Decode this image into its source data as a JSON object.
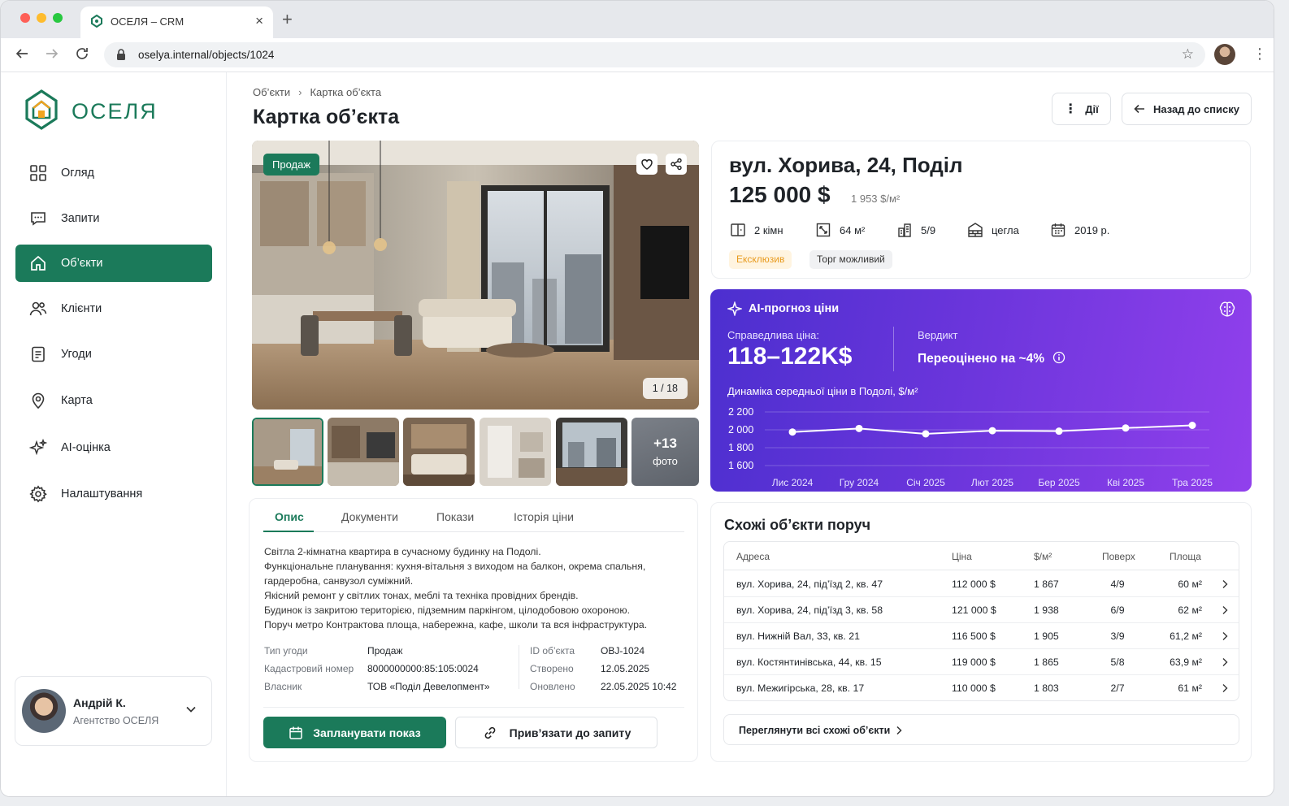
{
  "browser": {
    "tab_title": "ОСЕЛЯ – CRM",
    "url": "oselya.internal/objects/1024"
  },
  "sidebar": {
    "logo_text": "ОСЕЛЯ",
    "items": [
      {
        "label": "Огляд",
        "icon": "grid-icon",
        "active": false
      },
      {
        "label": "Запити",
        "icon": "chat-icon",
        "active": false
      },
      {
        "label": "Об’єкти",
        "icon": "home-icon",
        "active": true
      },
      {
        "label": "Клієнти",
        "icon": "users-icon",
        "active": false
      },
      {
        "label": "Угоди",
        "icon": "document-icon",
        "active": false
      },
      {
        "label": "Карта",
        "icon": "map-pin-icon",
        "active": false
      },
      {
        "label": "AI-оцінка",
        "icon": "sparkles-icon",
        "active": false
      },
      {
        "label": "Налаштування",
        "icon": "gear-icon",
        "active": false
      }
    ],
    "user": {
      "name": "Андрій К.",
      "org": "Агентство ОСЕЛЯ"
    }
  },
  "header": {
    "breadcrumb": [
      "Об’єкти",
      "Картка об’єкта"
    ],
    "title": "Картка об’єкта",
    "actions_label": "Дії",
    "back_label": "Назад до списку"
  },
  "gallery": {
    "badge": "Продаж",
    "counter": "1 / 18",
    "more_count": "+13",
    "more_label": "фото"
  },
  "tabs": [
    "Опис",
    "Документи",
    "Покази",
    "Історія ціни"
  ],
  "description": [
    "Світла 2-кімнатна квартира в сучасному будинку на Подолі.",
    "Функціональне планування: кухня-вітальня з виходом на балкон, окрема спальня,",
    "гардеробна, санвузол суміжний.",
    "Якісний ремонт у світлих тонах, меблі та техніка провідних брендів.",
    "Будинок із закритою територією, підземним паркінгом, цілодобовою охороною.",
    "Поруч метро Контрактова площа, набережна, кафе, школи та вся інфраструктура."
  ],
  "details_left": [
    {
      "k": "Тип угоди",
      "v": "Продаж"
    },
    {
      "k": "Кадастровий номер",
      "v": "8000000000:85:105:0024"
    },
    {
      "k": "Власник",
      "v": "ТОВ «Поділ Девелопмент»"
    }
  ],
  "details_right": [
    {
      "k": "ID об’єкта",
      "v": "OBJ-1024"
    },
    {
      "k": "Створено",
      "v": "12.05.2025"
    },
    {
      "k": "Оновлено",
      "v": "22.05.2025 10:42"
    }
  ],
  "buttons": {
    "schedule": "Запланувати показ",
    "link": "Прив’язати до запиту"
  },
  "object": {
    "address": "вул. Хорива, 24, Поділ",
    "price": "125 000 $",
    "price_per_m2": "1 953 $/м²",
    "features": [
      {
        "icon": "door-icon",
        "text": "2 кімн"
      },
      {
        "icon": "area-icon",
        "text": "64 м²"
      },
      {
        "icon": "building-icon",
        "text": "5/9"
      },
      {
        "icon": "brick-icon",
        "text": "цегла"
      },
      {
        "icon": "calendar-icon",
        "text": "2019 р."
      }
    ],
    "tags": [
      "Ексклюзив",
      "Торг можливий"
    ]
  },
  "ai": {
    "title": "AI-прогноз ціни",
    "fair_label": "Справедлива ціна:",
    "fair_value": "118–122K$",
    "verdict_label": "Вердикт",
    "verdict_value": "Переоцінено на ~4%",
    "chart_title": "Динаміка середньої ціни в Подолі, $/м²"
  },
  "chart_data": {
    "type": "line",
    "title": "Динаміка середньої ціни в Подолі, $/м²",
    "categories": [
      "Лис 2024",
      "Гру 2024",
      "Січ 2025",
      "Лют 2025",
      "Бер 2025",
      "Кві 2025",
      "Тра 2025"
    ],
    "values": [
      1975,
      2015,
      1955,
      1990,
      1985,
      2020,
      2050
    ],
    "yticks": [
      "2 200",
      "2 000",
      "1 800",
      "1 600"
    ],
    "ylim": [
      1600,
      2200
    ],
    "grid": true
  },
  "similar": {
    "title": "Схожі об’єкти поруч",
    "headers": [
      "Адреса",
      "Ціна",
      "$/м²",
      "Поверх",
      "Площа"
    ],
    "rows": [
      [
        "вул. Хорива, 24, під’їзд 2, кв. 47",
        "112 000 $",
        "1 867",
        "4/9",
        "60 м²"
      ],
      [
        "вул. Хорива, 24, під’їзд 3, кв. 58",
        "121 000 $",
        "1 938",
        "6/9",
        "62 м²"
      ],
      [
        "вул. Нижній Вал, 33, кв. 21",
        "116 500 $",
        "1 905",
        "3/9",
        "61,2 м²"
      ],
      [
        "вул. Костянтинівська, 44, кв. 15",
        "119 000 $",
        "1 865",
        "5/8",
        "63,9 м²"
      ],
      [
        "вул. Межигірська, 28, кв. 17",
        "110 000 $",
        "1 803",
        "2/7",
        "61 м²"
      ]
    ],
    "view_all": "Переглянути всі схожі об’єкти"
  },
  "colors": {
    "brand": "#1b7a5a",
    "ai_start": "#4c2fcf",
    "ai_end": "#9140ec",
    "tag_exclusive": "#e89a1d"
  }
}
